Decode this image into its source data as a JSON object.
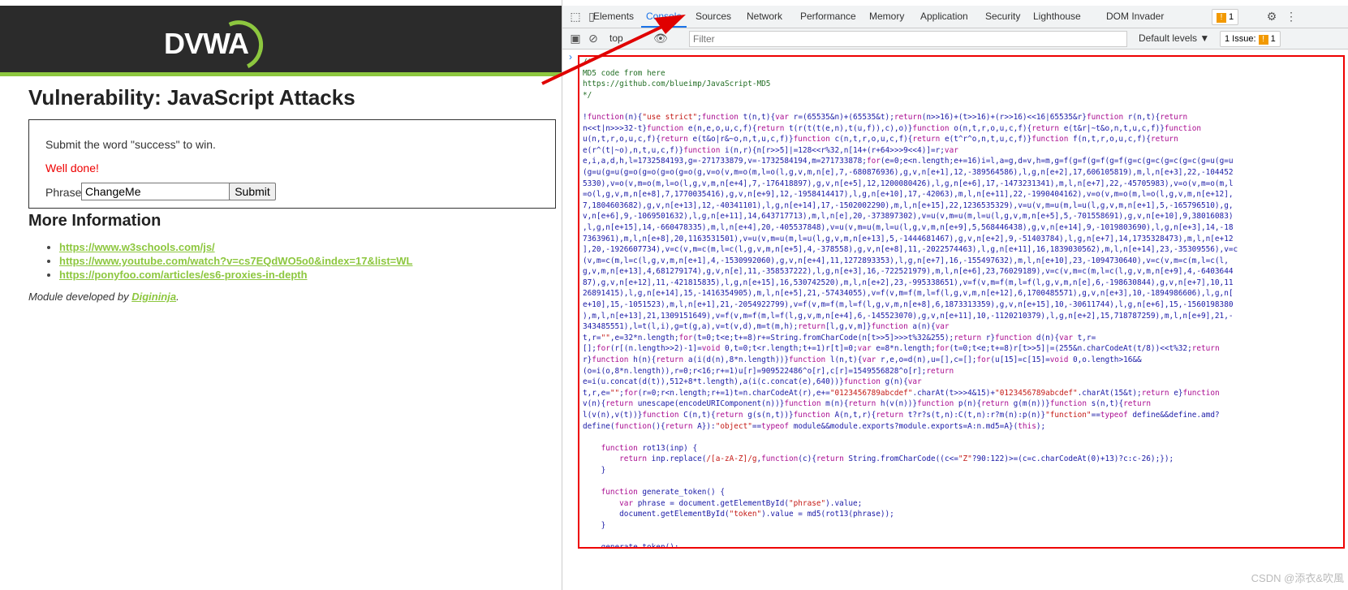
{
  "dvwa": {
    "logo_text": "DVWA",
    "page_title": "Vulnerability: JavaScript Attacks",
    "instruction": "Submit the word \"success\" to win.",
    "result_message": "Well done!",
    "phrase_label": "Phrase",
    "phrase_value": "ChangeMe",
    "submit_label": "Submit",
    "more_info_title": "More Information",
    "links": [
      "https://www.w3schools.com/js/",
      "https://www.youtube.com/watch?v=cs7EQdWO5o0&index=17&list=WL",
      "https://ponyfoo.com/articles/es6-proxies-in-depth"
    ],
    "footer_prefix": "Module developed by ",
    "footer_link": "Digininja",
    "footer_suffix": "."
  },
  "devtools": {
    "tabs": [
      "Elements",
      "Console",
      "Sources",
      "Network",
      "Performance",
      "Memory",
      "Application",
      "Security",
      "Lighthouse",
      "DOM Invader"
    ],
    "active_tab": "Console",
    "warning_count": "1",
    "context": "top",
    "filter_placeholder": "Filter",
    "levels_label": "Default levels ▼",
    "issues_label": "1 Issue:",
    "issues_count": "1"
  },
  "console_code": {
    "comment_lines": [
      "/*",
      "MD5 code from here",
      "https://github.com/blueimp/JavaScript-MD5",
      "*/"
    ]
  },
  "watermark": "CSDN @添衣&吹風",
  "colors": {
    "dvwa_green": "#8dc73f",
    "header_dark": "#2b2b2b",
    "annotation_red": "#e00000",
    "devtools_blue": "#1a73e8"
  }
}
